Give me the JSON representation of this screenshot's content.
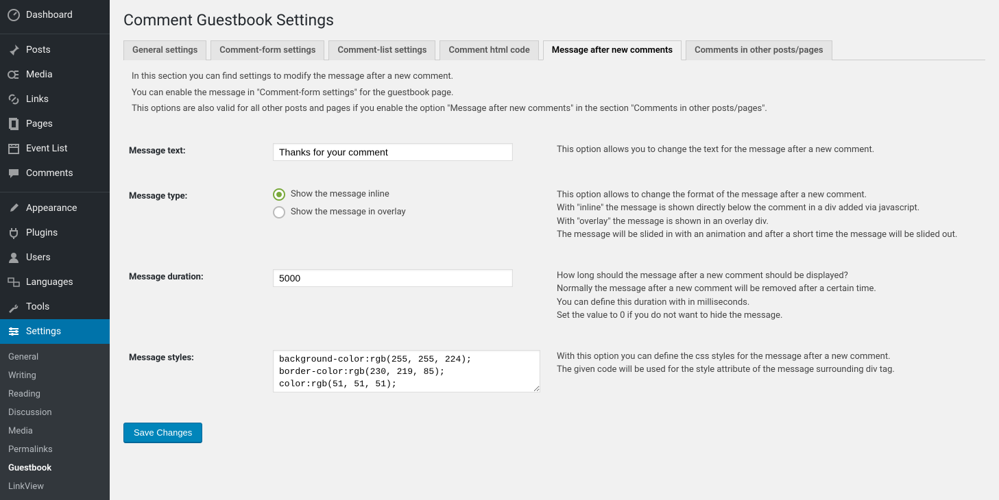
{
  "sidebar": {
    "items": [
      {
        "label": "Dashboard",
        "icon": "dashboard"
      },
      {
        "label": "Posts",
        "icon": "pin"
      },
      {
        "label": "Media",
        "icon": "media"
      },
      {
        "label": "Links",
        "icon": "link"
      },
      {
        "label": "Pages",
        "icon": "page"
      },
      {
        "label": "Event List",
        "icon": "calendar"
      },
      {
        "label": "Comments",
        "icon": "comment"
      },
      {
        "label": "Appearance",
        "icon": "brush"
      },
      {
        "label": "Plugins",
        "icon": "plug"
      },
      {
        "label": "Users",
        "icon": "user"
      },
      {
        "label": "Languages",
        "icon": "lang"
      },
      {
        "label": "Tools",
        "icon": "wrench"
      },
      {
        "label": "Settings",
        "icon": "gear",
        "active": true
      }
    ],
    "submenu": [
      {
        "label": "General"
      },
      {
        "label": "Writing"
      },
      {
        "label": "Reading"
      },
      {
        "label": "Discussion"
      },
      {
        "label": "Media"
      },
      {
        "label": "Permalinks"
      },
      {
        "label": "Guestbook",
        "current": true
      },
      {
        "label": "LinkView"
      }
    ]
  },
  "page": {
    "title": "Comment Guestbook Settings",
    "save_button": "Save Changes"
  },
  "tabs": [
    {
      "label": "General settings"
    },
    {
      "label": "Comment-form settings"
    },
    {
      "label": "Comment-list settings"
    },
    {
      "label": "Comment html code"
    },
    {
      "label": "Message after new comments",
      "active": true
    },
    {
      "label": "Comments in other posts/pages"
    }
  ],
  "intro": [
    "In this section you can find settings to modify the message after a new comment.",
    "You can enable the message in \"Comment-form settings\" for the guestbook page.",
    "This options are also valid for all other posts and pages if you enable the option \"Message after new comments\" in the section \"Comments in other posts/pages\"."
  ],
  "fields": {
    "message_text": {
      "label": "Message text:",
      "value": "Thanks for your comment",
      "help": "This option allows you to change the text for the message after a new comment."
    },
    "message_type": {
      "label": "Message type:",
      "options": [
        {
          "label": "Show the message inline",
          "checked": true
        },
        {
          "label": "Show the message in overlay",
          "checked": false
        }
      ],
      "help": [
        "This option allows to change the format of the message after a new comment.",
        "With \"inline\" the message is shown directly below the comment in a div added via javascript.",
        "With \"overlay\" the message is shown in an overlay div.",
        "The message will be slided in with an animation and after a short time the message will be slided out."
      ]
    },
    "message_duration": {
      "label": "Message duration:",
      "value": "5000",
      "help": [
        "How long should the message after a new comment should be displayed?",
        "Normally the message after a new comment will be removed after a certain time.",
        "You can define this duration with in milliseconds.",
        "Set the value to 0 if you do not want to hide the message."
      ]
    },
    "message_styles": {
      "label": "Message styles:",
      "value": "background-color:rgb(255, 255, 224);\nborder-color:rgb(230, 219, 85);\ncolor:rgb(51, 51, 51);",
      "help": [
        "With this option you can define the css styles for the message after a new comment.",
        "The given code will be used for the style attribute of the message surrounding div tag."
      ]
    }
  }
}
